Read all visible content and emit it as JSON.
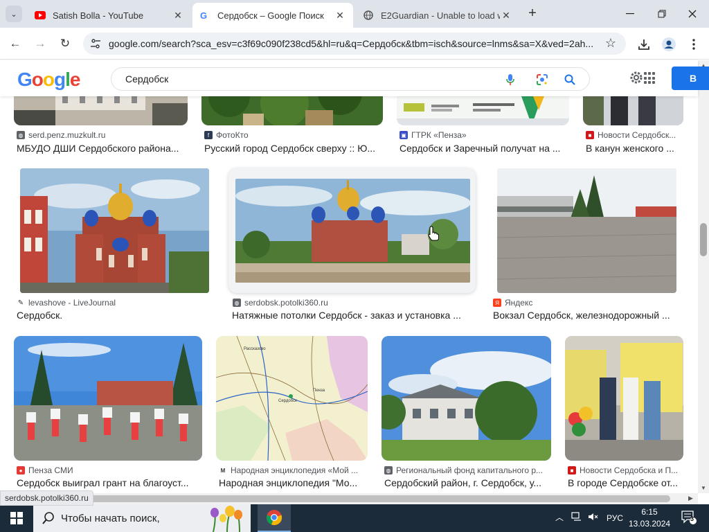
{
  "browser": {
    "tabs": [
      {
        "title": "Satish Bolla - YouTube",
        "favicon": "youtube-icon",
        "active": false
      },
      {
        "title": "Сердобск – Google Поиск",
        "favicon": "google-icon",
        "active": true
      },
      {
        "title": "E2Guardian - Unable to load we",
        "favicon": "globe-icon",
        "active": false
      }
    ],
    "url": "google.com/search?sca_esv=c3f69c090f238cd5&hl=ru&q=Сердобск&tbm=isch&source=lnms&sa=X&ved=2ah..."
  },
  "google": {
    "logo": "Google",
    "query": "Сердобск",
    "signin_label": "В"
  },
  "results": [
    {
      "source": "serd.penz.muzkult.ru",
      "title": "МБУДО ДШИ Сердобского района...",
      "source_icon": "globe-icon"
    },
    {
      "source": "ФотоКто",
      "title": "Русский город Сердобск сверху :: Ю...",
      "source_icon": "fotokto-icon"
    },
    {
      "source": "ГТРК «Пенза»",
      "title": "Сердобск и Заречный получат на ...",
      "source_icon": "gtrk-icon"
    },
    {
      "source": "Новости Сердобск...",
      "title": "В канун женского ...",
      "source_icon": "news-icon"
    },
    {
      "source": "levashove - LiveJournal",
      "title": "Сердобск.",
      "source_icon": "livejournal-icon"
    },
    {
      "source": "serdobsk.potolki360.ru",
      "title": "Натяжные потолки Сердобск - заказ и установка ...",
      "source_icon": "globe-icon"
    },
    {
      "source": "Яндекс",
      "title": "Вокзал Сердобск, железнодорожный ...",
      "source_icon": "yandex-icon"
    },
    {
      "source": "Пенза СМИ",
      "title": "Сердобск выиграл грант на благоуст...",
      "source_icon": "penza-smi-icon"
    },
    {
      "source": "Народная энциклопедия «Мой ...",
      "title": "Народная энциклопедия \"Мо...",
      "source_icon": "encyclopedia-icon"
    },
    {
      "source": "Региональный фонд капитального р...",
      "title": "Сердобский район, г. Сердобск, у...",
      "source_icon": "globe-icon"
    },
    {
      "source": "Новости Сердобска и П...",
      "title": "В городе Сердобске от...",
      "source_icon": "news-icon"
    }
  ],
  "status_url": "serdobsk.potolki360.ru",
  "taskbar": {
    "search_placeholder": "Чтобы начать поиск,",
    "language": "РУС",
    "time": "6:15",
    "date": "13.03.2024",
    "notification_count": "3"
  },
  "colors": {
    "google_blue": "#4285f4",
    "google_red": "#ea4335",
    "google_yellow": "#fbbc05",
    "google_green": "#34a853",
    "signin": "#1a73e8",
    "taskbar": "#1c2b3a"
  }
}
